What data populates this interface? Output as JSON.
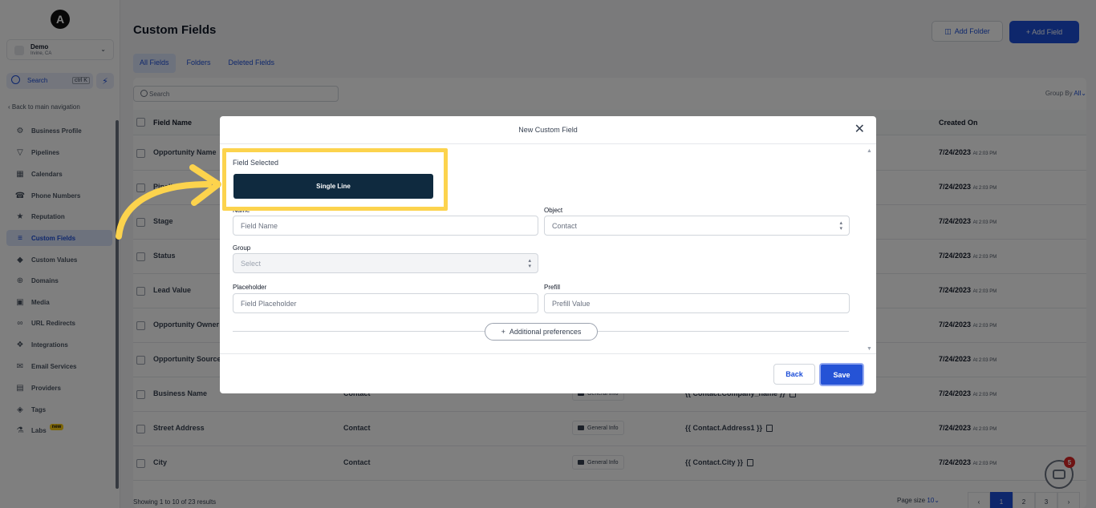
{
  "sidebar": {
    "logo": "A",
    "account": {
      "name": "Demo",
      "location": "Irvine, CA"
    },
    "search": {
      "label": "Search",
      "shortcut": "ctrl K"
    },
    "back_link": "Back to main navigation",
    "items": [
      {
        "label": "Business Profile",
        "icon": "gear-icon"
      },
      {
        "label": "Pipelines",
        "icon": "filter-icon"
      },
      {
        "label": "Calendars",
        "icon": "calendar-icon"
      },
      {
        "label": "Phone Numbers",
        "icon": "phone-icon"
      },
      {
        "label": "Reputation",
        "icon": "star-icon"
      },
      {
        "label": "Custom Fields",
        "icon": "fields-icon"
      },
      {
        "label": "Custom Values",
        "icon": "diamond-icon"
      },
      {
        "label": "Domains",
        "icon": "globe-icon"
      },
      {
        "label": "Media",
        "icon": "image-icon"
      },
      {
        "label": "URL Redirects",
        "icon": "link-icon"
      },
      {
        "label": "Integrations",
        "icon": "puzzle-icon"
      },
      {
        "label": "Email Services",
        "icon": "mail-icon"
      },
      {
        "label": "Providers",
        "icon": "server-icon"
      },
      {
        "label": "Tags",
        "icon": "tag-icon"
      },
      {
        "label": "Labs",
        "icon": "flask-icon",
        "badge": "new"
      }
    ]
  },
  "header": {
    "title": "Custom Fields",
    "add_folder": "Add Folder",
    "add_field": "+ Add Field"
  },
  "tabs": [
    "All Fields",
    "Folders",
    "Deleted Fields"
  ],
  "table": {
    "search_placeholder": "Search",
    "group_by_label": "Group By",
    "group_by_value": "All",
    "columns": {
      "name": "Field Name",
      "created": "Created On"
    },
    "rows": [
      {
        "name": "Opportunity Name",
        "object": "",
        "folder": "",
        "key": "",
        "date": "7/24/2023",
        "time": "At 2:03 PM"
      },
      {
        "name": "Pipeline",
        "object": "",
        "folder": "",
        "key": "",
        "date": "7/24/2023",
        "time": "At 2:03 PM"
      },
      {
        "name": "Stage",
        "object": "",
        "folder": "",
        "key": "",
        "date": "7/24/2023",
        "time": "At 2:03 PM"
      },
      {
        "name": "Status",
        "object": "",
        "folder": "",
        "key": "",
        "date": "7/24/2023",
        "time": "At 2:03 PM"
      },
      {
        "name": "Lead Value",
        "object": "",
        "folder": "",
        "key": "",
        "date": "7/24/2023",
        "time": "At 2:03 PM"
      },
      {
        "name": "Opportunity Owner",
        "object": "",
        "folder": "",
        "key": "",
        "date": "7/24/2023",
        "time": "At 2:03 PM"
      },
      {
        "name": "Opportunity Source",
        "object": "",
        "folder": "",
        "key": "",
        "date": "7/24/2023",
        "time": "At 2:03 PM"
      },
      {
        "name": "Business Name",
        "object": "Contact",
        "folder": "General Info",
        "key": "{{ Contact.Company_name }}",
        "date": "7/24/2023",
        "time": "At 2:03 PM"
      },
      {
        "name": "Street Address",
        "object": "Contact",
        "folder": "General Info",
        "key": "{{ Contact.Address1 }}",
        "date": "7/24/2023",
        "time": "At 2:03 PM"
      },
      {
        "name": "City",
        "object": "Contact",
        "folder": "General Info",
        "key": "{{ Contact.City }}",
        "date": "7/24/2023",
        "time": "At 2:03 PM"
      }
    ],
    "footer": "Showing 1 to 10 of 23 results",
    "page_size_label": "Page size",
    "page_size_value": "10",
    "pages": [
      "1",
      "2",
      "3"
    ]
  },
  "chat": {
    "badge": "5"
  },
  "modal": {
    "title": "New Custom Field",
    "field_selected_label": "Field Selected",
    "field_type": "Single Line",
    "name_label": "Name",
    "name_placeholder": "Field Name",
    "object_label": "Object",
    "object_value": "Contact",
    "group_label": "Group",
    "group_placeholder": "Select",
    "placeholder_label": "Placeholder",
    "placeholder_placeholder": "Field Placeholder",
    "prefill_label": "Prefill",
    "prefill_placeholder": "Prefill Value",
    "additional_preferences": "Additional preferences",
    "back": "Back",
    "save": "Save"
  },
  "colors": {
    "accent": "#1d4ed8",
    "field_type_bg": "#0f2a3f",
    "highlight": "#fcd34d"
  }
}
